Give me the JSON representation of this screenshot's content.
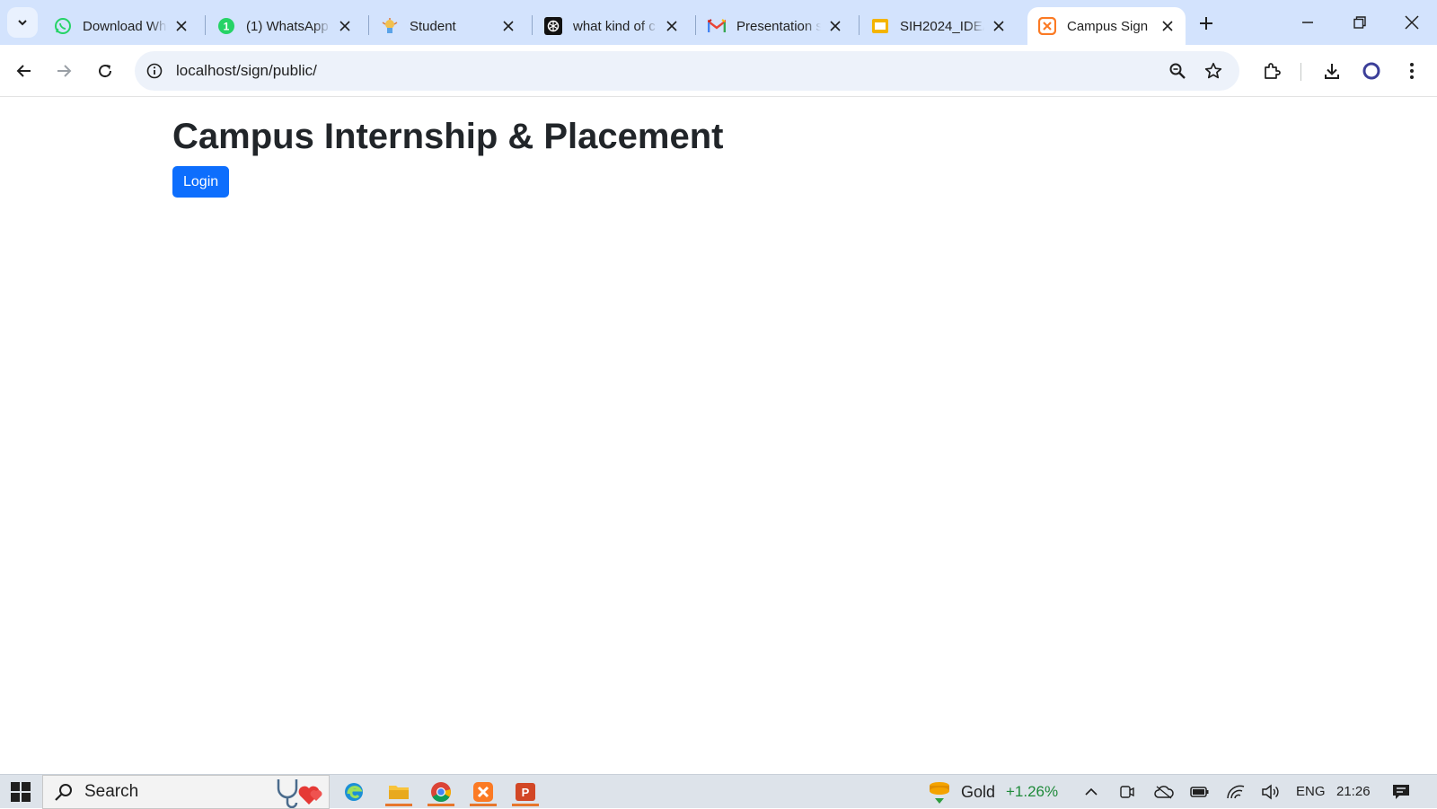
{
  "browser": {
    "tabs": [
      {
        "title": "Download Wh",
        "icon": "whatsapp-icon"
      },
      {
        "title": "(1) WhatsApp",
        "icon": "whatsapp-badge-icon"
      },
      {
        "title": "Student",
        "icon": "student-icon"
      },
      {
        "title": "what kind of c",
        "icon": "chatgpt-icon"
      },
      {
        "title": "Presentation s",
        "icon": "gmail-icon"
      },
      {
        "title": "SIH2024_IDEA",
        "icon": "slides-icon"
      },
      {
        "title": "Campus Sign",
        "icon": "xampp-icon",
        "active": true
      }
    ],
    "url": "localhost/sign/public/"
  },
  "page": {
    "heading": "Campus Internship & Placement",
    "login_label": "Login"
  },
  "taskbar": {
    "search_placeholder": "Search",
    "widget_name": "Gold",
    "widget_change": "+1.26%",
    "language": "ENG",
    "time": "21:26"
  },
  "colors": {
    "tabstrip": "#d3e3fd",
    "omnibox": "#edf2fa",
    "primary_button": "#0d6efd",
    "heading_text": "#212529",
    "positive_change": "#1f8a3a",
    "taskbar": "#dde3ea"
  }
}
